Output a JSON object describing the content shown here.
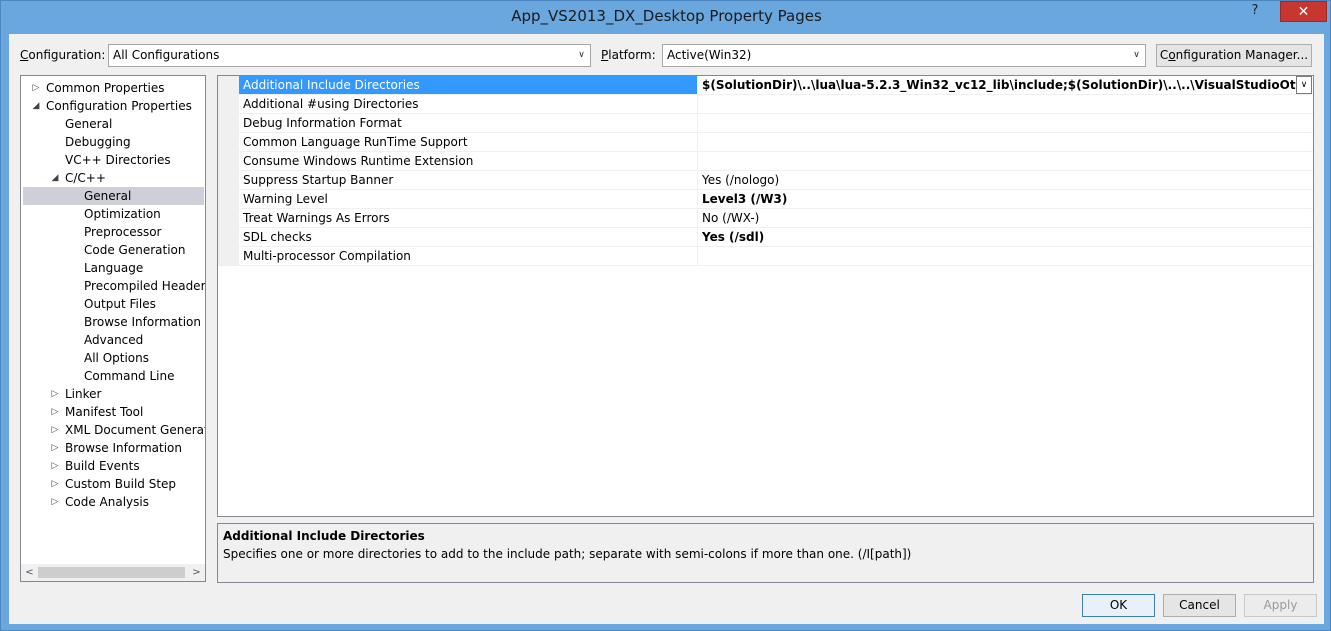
{
  "window": {
    "title": "App_VS2013_DX_Desktop Property Pages",
    "help_label": "?",
    "close_label": "✕"
  },
  "toolbar": {
    "configuration_label_pre": "",
    "configuration_label_u": "C",
    "configuration_label_post": "onfiguration:",
    "configuration_value": "All Configurations",
    "platform_label_pre": "",
    "platform_label_u": "P",
    "platform_label_post": "latform:",
    "platform_value": "Active(Win32)",
    "config_manager_pre": "C",
    "config_manager_u": "o",
    "config_manager_post": "nfiguration Manager..."
  },
  "tree": {
    "items": [
      {
        "label": "Common Properties",
        "expander": "▷"
      },
      {
        "label": "Configuration Properties",
        "expander": "◢"
      },
      {
        "label": "General",
        "expander": ""
      },
      {
        "label": "Debugging",
        "expander": ""
      },
      {
        "label": "VC++ Directories",
        "expander": ""
      },
      {
        "label": "C/C++",
        "expander": "◢"
      },
      {
        "label": "General",
        "expander": ""
      },
      {
        "label": "Optimization",
        "expander": ""
      },
      {
        "label": "Preprocessor",
        "expander": ""
      },
      {
        "label": "Code Generation",
        "expander": ""
      },
      {
        "label": "Language",
        "expander": ""
      },
      {
        "label": "Precompiled Headers",
        "expander": ""
      },
      {
        "label": "Output Files",
        "expander": ""
      },
      {
        "label": "Browse Information",
        "expander": ""
      },
      {
        "label": "Advanced",
        "expander": ""
      },
      {
        "label": "All Options",
        "expander": ""
      },
      {
        "label": "Command Line",
        "expander": ""
      },
      {
        "label": "Linker",
        "expander": "▷"
      },
      {
        "label": "Manifest Tool",
        "expander": "▷"
      },
      {
        "label": "XML Document Generator",
        "expander": "▷"
      },
      {
        "label": "Browse Information",
        "expander": "▷"
      },
      {
        "label": "Build Events",
        "expander": "▷"
      },
      {
        "label": "Custom Build Step",
        "expander": "▷"
      },
      {
        "label": "Code Analysis",
        "expander": "▷"
      }
    ],
    "scroll_left": "<",
    "scroll_right": ">"
  },
  "properties": [
    {
      "name": "Additional Include Directories",
      "value": "$(SolutionDir)\\..\\lua\\lua-5.2.3_Win32_vc12_lib\\include;$(SolutionDir)\\..\\..\\VisualStudioOtherLibs\\include;C:\\p"
    },
    {
      "name": "Additional #using Directories",
      "value": ""
    },
    {
      "name": "Debug Information Format",
      "value": ""
    },
    {
      "name": "Common Language RunTime Support",
      "value": ""
    },
    {
      "name": "Consume Windows Runtime Extension",
      "value": ""
    },
    {
      "name": "Suppress Startup Banner",
      "value": "Yes (/nologo)"
    },
    {
      "name": "Warning Level",
      "value": "Level3 (/W3)"
    },
    {
      "name": "Treat Warnings As Errors",
      "value": "No (/WX-)"
    },
    {
      "name": "SDL checks",
      "value": "Yes (/sdl)"
    },
    {
      "name": "Multi-processor Compilation",
      "value": ""
    }
  ],
  "description": {
    "title": "Additional Include Directories",
    "text": "Specifies one or more directories to add to the include path; separate with semi-colons if more than one.     (/I[path])"
  },
  "buttons": {
    "ok": "OK",
    "cancel": "Cancel",
    "apply": "Apply"
  }
}
